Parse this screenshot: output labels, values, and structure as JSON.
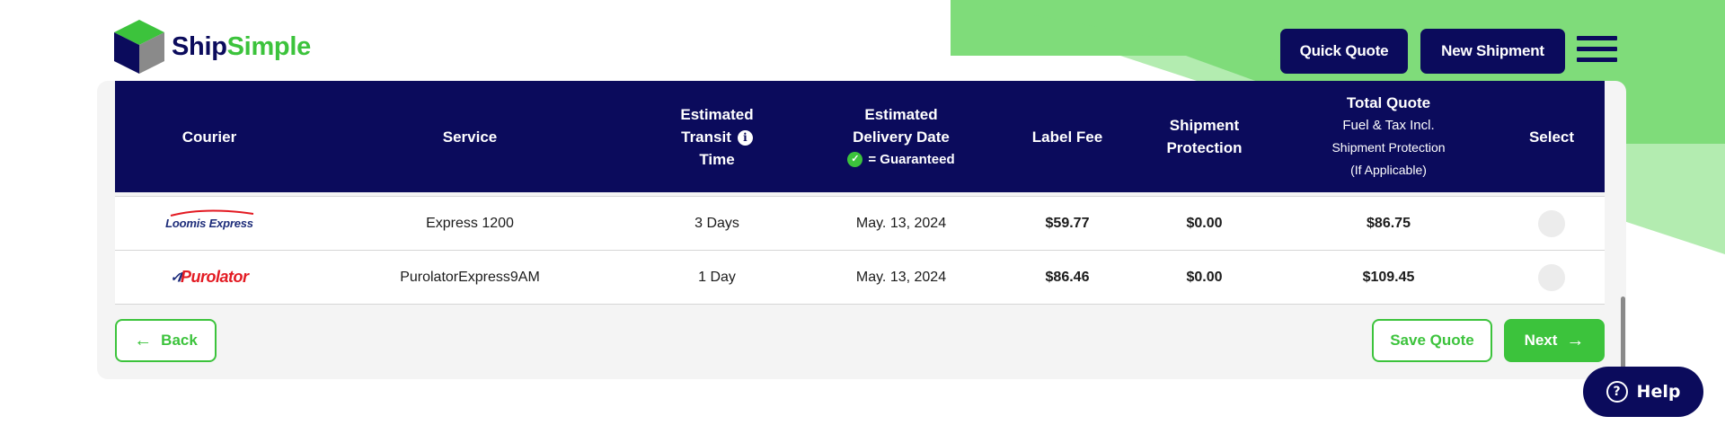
{
  "brand": {
    "name_part1": "Ship",
    "name_part2": "Simple"
  },
  "header": {
    "quick_quote": "Quick Quote",
    "new_shipment": "New Shipment"
  },
  "table": {
    "columns": {
      "courier": "Courier",
      "service": "Service",
      "transit_line1": "Estimated",
      "transit_line2": "Transit",
      "transit_line3": "Time",
      "delivery_line1": "Estimated",
      "delivery_line2": "Delivery Date",
      "delivery_guaranteed": "= Guaranteed",
      "label_fee": "Label Fee",
      "protection_line1": "Shipment",
      "protection_line2": "Protection",
      "total_line1": "Total Quote",
      "total_line2": "Fuel & Tax Incl.",
      "total_line3": "Shipment Protection",
      "total_line4": "(If Applicable)",
      "select": "Select"
    },
    "rows": [
      {
        "courier": "Loomis Express",
        "service": "Express 1200",
        "transit": "3 Days",
        "delivery": "May. 13, 2024",
        "label_fee": "$59.77",
        "protection": "$0.00",
        "total": "$86.75"
      },
      {
        "courier": "Purolator",
        "service": "PurolatorExpress9AM",
        "transit": "1 Day",
        "delivery": "May. 13, 2024",
        "label_fee": "$86.46",
        "protection": "$0.00",
        "total": "$109.45"
      }
    ]
  },
  "footer": {
    "back": "Back",
    "save_quote": "Save Quote",
    "next": "Next"
  },
  "help": {
    "label": "Help"
  },
  "colors": {
    "navy": "#0b0b5c",
    "green": "#3cc33c",
    "light_green": "#7cdc7c"
  },
  "icons": [
    "cube-logo-icon",
    "menu-icon",
    "info-icon",
    "check-circle-icon",
    "arrow-left-icon",
    "arrow-right-icon",
    "question-icon"
  ]
}
